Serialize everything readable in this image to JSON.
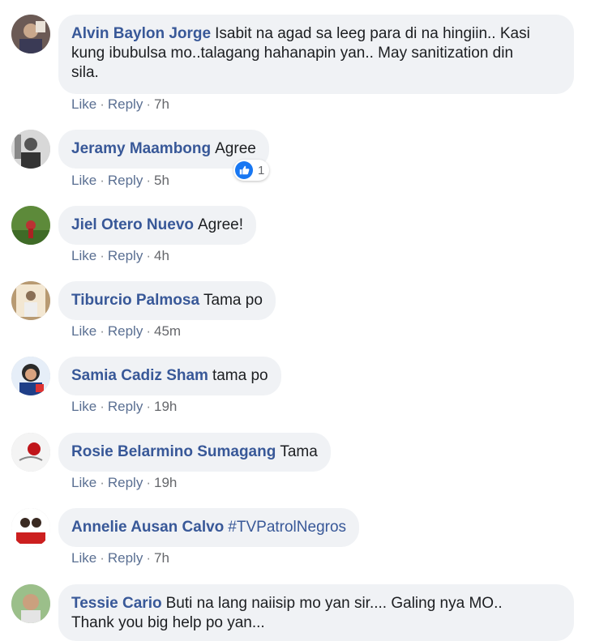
{
  "actions": {
    "like": "Like",
    "reply": "Reply",
    "separator": "·"
  },
  "colors": {
    "author": "#385898",
    "bubble": "#f0f2f5",
    "like_blue": "#1877f2"
  },
  "comments": [
    {
      "author": "Alvin Baylon Jorge",
      "text_line1": "Isabit na agad sa leeg para di na hingiin.. Kasi",
      "text_line2": "kung ibubulsa mo..talagang hahanapin yan.. May sanitization din",
      "text_line3": "sila.",
      "time": "7h",
      "avatar_icon": "avatar-photo"
    },
    {
      "author": "Jeramy Maambong",
      "text": "Agree",
      "time": "5h",
      "reactions": {
        "icon": "like-reaction-icon",
        "count": "1"
      },
      "avatar_icon": "avatar-photo"
    },
    {
      "author": "Jiel Otero Nuevo",
      "text": "Agree!",
      "time": "4h",
      "avatar_icon": "avatar-photo"
    },
    {
      "author": "Tiburcio Palmosa",
      "text": "Tama po",
      "time": "45m",
      "avatar_icon": "avatar-photo"
    },
    {
      "author": "Samia Cadiz Sham",
      "text": "tama po",
      "time": "19h",
      "avatar_icon": "avatar-photo"
    },
    {
      "author": "Rosie Belarmino Sumagang",
      "text": "Tama",
      "time": "19h",
      "avatar_icon": "avatar-photo"
    },
    {
      "author": "Annelie Ausan Calvo",
      "hashtag": "#TVPatrolNegros",
      "time": "7h",
      "avatar_icon": "avatar-photo"
    },
    {
      "author": "Tessie Cario",
      "text_line1": "Buti na lang naiisip mo yan sir.... Galing nya MO..",
      "text_line2": "Thank you big help po yan...",
      "avatar_icon": "avatar-photo"
    }
  ]
}
